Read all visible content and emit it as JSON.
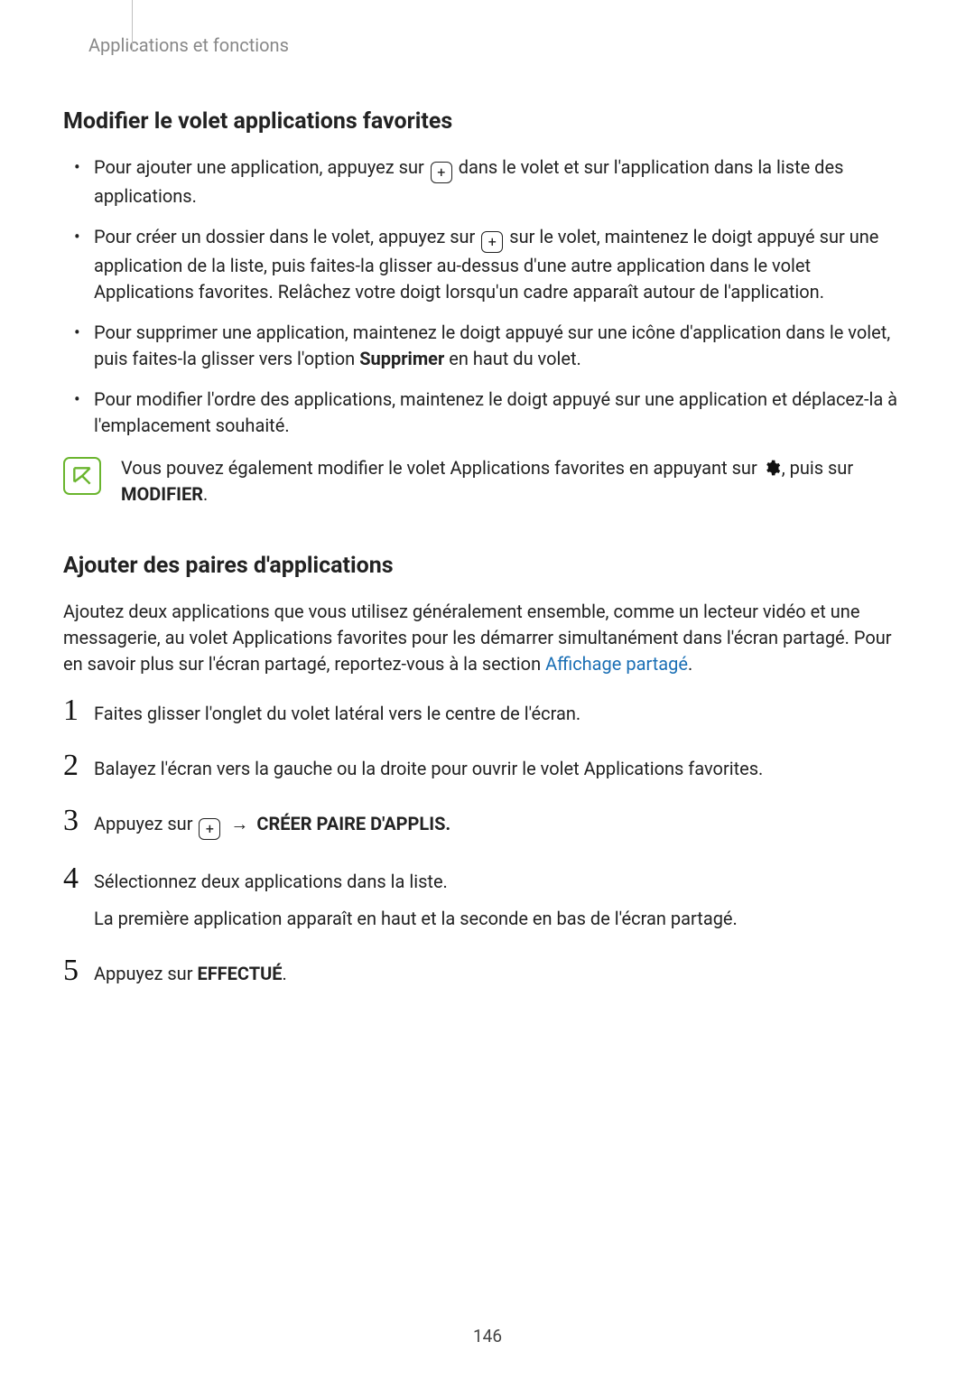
{
  "breadcrumb": "Applications et fonctions",
  "heading1": "Modifier le volet applications favorites",
  "bullets": {
    "b1a": "Pour ajouter une application, appuyez sur ",
    "b1b": " dans le volet et sur l'application dans la liste des applications.",
    "b2a": "Pour créer un dossier dans le volet, appuyez sur ",
    "b2b": " sur le volet, maintenez le doigt appuyé sur une application de la liste, puis faites-la glisser au-dessus d'une autre application dans le volet Applications favorites. Relâchez votre doigt lorsqu'un cadre apparaît autour de l'application.",
    "b3a": "Pour supprimer une application, maintenez le doigt appuyé sur une icône d'application dans le volet, puis faites-la glisser vers l'option ",
    "b3bold": "Supprimer",
    "b3b": " en haut du volet.",
    "b4": "Pour modifier l'ordre des applications, maintenez le doigt appuyé sur une application et déplacez-la à l'emplacement souhaité."
  },
  "note": {
    "pre": "Vous pouvez également modifier le volet Applications favorites en appuyant sur ",
    "post": ", puis sur ",
    "bold": "MODIFIER",
    "dot": "."
  },
  "heading2": "Ajouter des paires d'applications",
  "intro": {
    "t1": "Ajoutez deux applications que vous utilisez généralement ensemble, comme un lecteur vidéo et une messagerie, au volet Applications favorites pour les démarrer simultanément dans l'écran partagé. Pour en savoir plus sur l'écran partagé, reportez-vous à la section ",
    "link": "Affichage partagé",
    "t2": "."
  },
  "steps": {
    "s1": "Faites glisser l'onglet du volet latéral vers le centre de l'écran.",
    "s2": "Balayez l'écran vers la gauche ou la droite pour ouvrir le volet Applications favorites.",
    "s3a": "Appuyez sur ",
    "s3arrow": " → ",
    "s3bold": "CRÉER PAIRE D'APPLIS.",
    "s4": "Sélectionnez deux applications dans la liste.",
    "s4b": "La première application apparaît en haut et la seconde en bas de l'écran partagé.",
    "s5a": "Appuyez sur ",
    "s5bold": "EFFECTUÉ",
    "s5b": "."
  },
  "nums": {
    "n1": "1",
    "n2": "2",
    "n3": "3",
    "n4": "4",
    "n5": "5"
  },
  "page_number": "146"
}
